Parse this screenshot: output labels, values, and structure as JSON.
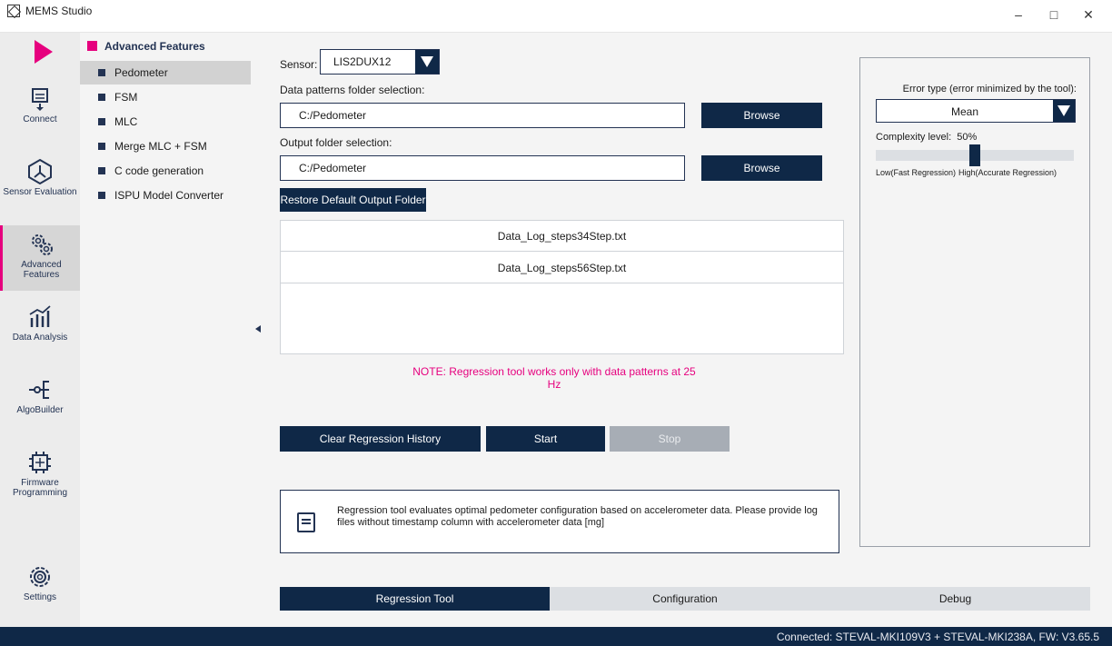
{
  "window": {
    "title": "MEMS Studio",
    "controls": {
      "minimize": "–",
      "maximize": "□",
      "close": "✕"
    }
  },
  "rail": {
    "run_icon": "play-icon",
    "items": [
      {
        "label": "Connect",
        "icon": "connect-icon"
      },
      {
        "label": "Sensor Evaluation",
        "icon": "sensor-evaluation-icon"
      },
      {
        "label": "Advanced Features",
        "icon": "advanced-features-icon"
      },
      {
        "label": "Data Analysis",
        "icon": "data-analysis-icon"
      },
      {
        "label": "AlgoBuilder",
        "icon": "algobuilder-icon"
      },
      {
        "label": "Firmware Programming",
        "icon": "firmware-programming-icon"
      },
      {
        "label": "Settings",
        "icon": "settings-icon"
      }
    ]
  },
  "submenu": {
    "heading": "Advanced Features",
    "items": [
      "Pedometer",
      "FSM",
      "MLC",
      "Merge MLC + FSM",
      "C code generation",
      "ISPU Model Converter"
    ]
  },
  "main": {
    "sensor_label": "Sensor:",
    "sensor_value": "LIS2DUX12",
    "data_patterns_label": "Data patterns folder selection:",
    "data_patterns_path": "C:/Pedometer",
    "browse_label": "Browse",
    "output_folder_label": "Output folder selection:",
    "output_folder_path": "C:/Pedometer",
    "restore_default_label": "Restore Default Output Folder",
    "files": [
      "Data_Log_steps34Step.txt",
      "Data_Log_steps56Step.txt"
    ],
    "note": "NOTE: Regression tool works only with data patterns at 25 Hz",
    "clear_history_label": "Clear Regression History",
    "start_label": "Start",
    "stop_label": "Stop",
    "info_text": "Regression tool evaluates optimal pedometer configuration based on accelerometer data. Please provide log files without timestamp column with accelerometer data [mg]"
  },
  "right_panel": {
    "error_type_label": "Error type (error minimized by the tool):",
    "error_type_value": "Mean",
    "complexity_label": "Complexity level:",
    "complexity_value": "50%",
    "complexity_fraction": 0.5,
    "slider_low_label": "Low(Fast Regression)",
    "slider_high_label": "High(Accurate Regression)"
  },
  "tabs": [
    "Regression Tool",
    "Configuration",
    "Debug"
  ],
  "status": {
    "text": "Connected:  STEVAL-MKI109V3 + STEVAL-MKI238A, FW: V3.65.5"
  },
  "colors": {
    "accent": "#e6007e",
    "navy": "#0f2847",
    "disabled": "#a7adb5"
  }
}
